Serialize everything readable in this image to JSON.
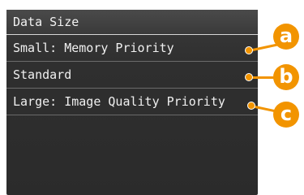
{
  "screen": {
    "title": "Data Size",
    "items": [
      {
        "label": "Small: Memory Priority",
        "callout": "a"
      },
      {
        "label": "Standard",
        "callout": "b"
      },
      {
        "label": "Large: Image Quality Priority",
        "callout": "c"
      }
    ]
  },
  "colors": {
    "callout": "#f29400",
    "screen_bg": "#2f2f2f",
    "text": "#f0f0f0"
  }
}
